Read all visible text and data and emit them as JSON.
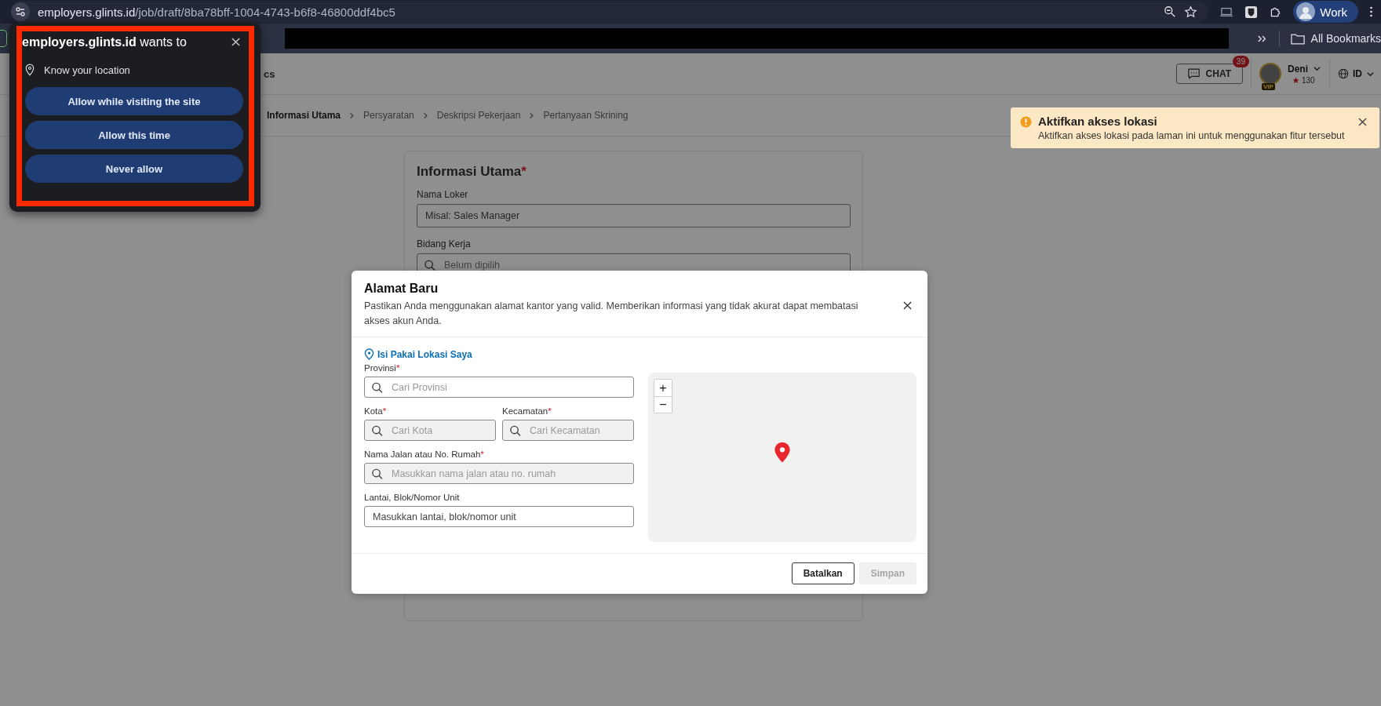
{
  "browser": {
    "url_host": "employers.glints.id",
    "url_path": "/job/draft/8ba78bff-1004-4743-b6f8-46800ddf4bc5",
    "profile": "Work",
    "bookmarks_label": "All Bookmarks"
  },
  "permission_popup": {
    "site": "employers.glints.id",
    "title_suffix": "wants to",
    "permission": "Know your location",
    "buttons": [
      "Allow while visiting the site",
      "Allow this time",
      "Never allow"
    ]
  },
  "header": {
    "nav_fragment": "cs",
    "chat_label": "CHAT",
    "chat_badge": "39",
    "user_name": "Deni",
    "avatar_badge": "VIP",
    "points": "130",
    "language": "ID"
  },
  "breadcrumb": [
    {
      "label": "Informasi Utama",
      "selected": true
    },
    {
      "label": "Persyaratan",
      "selected": false
    },
    {
      "label": "Deskripsi Pekerjaan",
      "selected": false
    },
    {
      "label": "Pertanyaan Skrining",
      "selected": false
    }
  ],
  "form": {
    "title": "Informasi Utama",
    "title_mark": "*",
    "fields": [
      {
        "label": "Nama Loker",
        "placeholder": "Misal: Sales Manager",
        "kind": "text"
      },
      {
        "label": "Bidang Kerja",
        "placeholder": "Belum dipilih",
        "kind": "search"
      }
    ]
  },
  "toast": {
    "title": "Aktifkan akses lokasi",
    "message": "Aktifkan akses lokasi pada laman ini untuk menggunakan fitur tersebut"
  },
  "modal": {
    "title": "Alamat Baru",
    "description": "Pastikan Anda menggunakan alamat kantor yang valid. Memberikan informasi yang tidak akurat dapat membatasi akses akun Anda.",
    "locate_link": "Isi Pakai Lokasi Saya",
    "rows": [
      [
        {
          "label": "Provinsi",
          "mark": "*",
          "placeholder": "Cari Provinsi",
          "kind": "search",
          "disabled": false
        }
      ],
      [
        {
          "label": "Kota",
          "mark": "*",
          "placeholder": "Cari Kota",
          "kind": "search",
          "disabled": true
        },
        {
          "label": "Kecamatan",
          "mark": "*",
          "placeholder": "Cari Kecamatan",
          "kind": "search",
          "disabled": true
        }
      ],
      [
        {
          "label": "Nama Jalan atau No. Rumah",
          "mark": "*",
          "placeholder": "Masukkan nama jalan atau no. rumah",
          "kind": "search",
          "disabled": true
        }
      ],
      [
        {
          "label": "Lantai, Blok/Nomor Unit",
          "placeholder": "Masukkan lantai, blok/nomor unit",
          "kind": "text",
          "disabled": false
        }
      ]
    ],
    "map": {
      "zoom_in": "+",
      "zoom_out": "−"
    },
    "buttons": [
      {
        "label": "Batalkan",
        "disabled": false
      },
      {
        "label": "Simpan",
        "disabled": true
      }
    ]
  }
}
